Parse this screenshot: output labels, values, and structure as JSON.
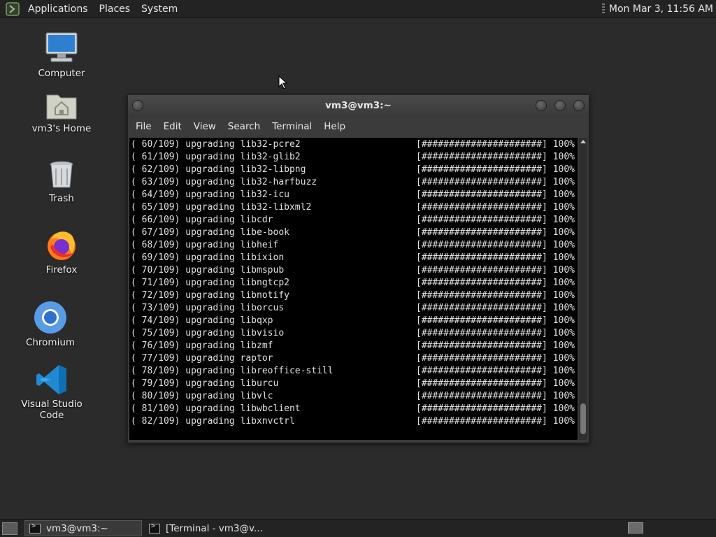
{
  "top_panel": {
    "menus": [
      "Applications",
      "Places",
      "System"
    ],
    "clock": "Mon Mar  3, 11:56 AM"
  },
  "desktop": {
    "icons": [
      {
        "label": "Computer",
        "icon": "computer-icon"
      },
      {
        "label": "vm3's Home",
        "icon": "home-folder-icon"
      },
      {
        "label": "Trash",
        "icon": "trash-icon"
      },
      {
        "label": "Firefox",
        "icon": "firefox-icon"
      },
      {
        "label": "Chromium",
        "icon": "chromium-icon"
      },
      {
        "label": "Visual Studio Code",
        "icon": "vscode-icon"
      }
    ]
  },
  "window": {
    "title": "vm3@vm3:~",
    "menu": [
      "File",
      "Edit",
      "View",
      "Search",
      "Terminal",
      "Help"
    ],
    "lines": [
      {
        "text": "( 60/109) upgrading lib32-pcre2",
        "progress": "[######################] 100%"
      },
      {
        "text": "( 61/109) upgrading lib32-glib2",
        "progress": "[######################] 100%"
      },
      {
        "text": "( 62/109) upgrading lib32-libpng",
        "progress": "[######################] 100%"
      },
      {
        "text": "( 63/109) upgrading lib32-harfbuzz",
        "progress": "[######################] 100%"
      },
      {
        "text": "( 64/109) upgrading lib32-icu",
        "progress": "[######################] 100%"
      },
      {
        "text": "( 65/109) upgrading lib32-libxml2",
        "progress": "[######################] 100%"
      },
      {
        "text": "( 66/109) upgrading libcdr",
        "progress": "[######################] 100%"
      },
      {
        "text": "( 67/109) upgrading libe-book",
        "progress": "[######################] 100%"
      },
      {
        "text": "( 68/109) upgrading libheif",
        "progress": "[######################] 100%"
      },
      {
        "text": "( 69/109) upgrading libixion",
        "progress": "[######################] 100%"
      },
      {
        "text": "( 70/109) upgrading libmspub",
        "progress": "[######################] 100%"
      },
      {
        "text": "( 71/109) upgrading libngtcp2",
        "progress": "[######################] 100%"
      },
      {
        "text": "( 72/109) upgrading libnotify",
        "progress": "[######################] 100%"
      },
      {
        "text": "( 73/109) upgrading liborcus",
        "progress": "[######################] 100%"
      },
      {
        "text": "( 74/109) upgrading libqxp",
        "progress": "[######################] 100%"
      },
      {
        "text": "( 75/109) upgrading libvisio",
        "progress": "[######################] 100%"
      },
      {
        "text": "( 76/109) upgrading libzmf",
        "progress": "[######################] 100%"
      },
      {
        "text": "( 77/109) upgrading raptor",
        "progress": "[######################] 100%"
      },
      {
        "text": "( 78/109) upgrading libreoffice-still",
        "progress": "[######################] 100%"
      },
      {
        "text": "( 79/109) upgrading liburcu",
        "progress": "[######################] 100%"
      },
      {
        "text": "( 80/109) upgrading libvlc",
        "progress": "[######################] 100%"
      },
      {
        "text": "( 81/109) upgrading libwbclient",
        "progress": "[######################] 100%"
      },
      {
        "text": "( 82/109) upgrading libxnvctrl",
        "progress": "[######################] 100%"
      }
    ]
  },
  "taskbar": {
    "tasks": [
      {
        "label": "vm3@vm3:~"
      },
      {
        "label": "[Terminal - vm3@v..."
      }
    ]
  }
}
